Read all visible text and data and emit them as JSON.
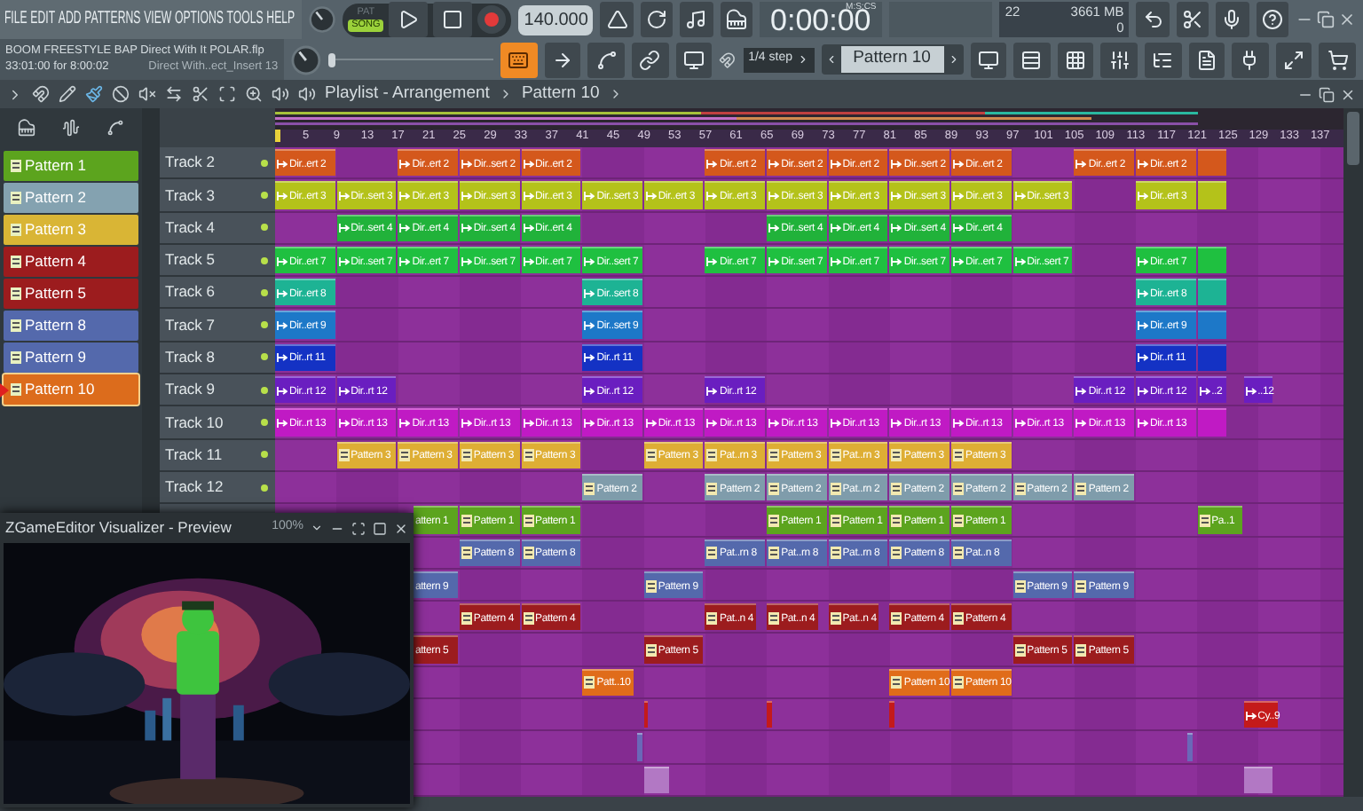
{
  "menu": [
    "FILE",
    "EDIT",
    "ADD",
    "PATTERNS",
    "VIEW",
    "OPTIONS",
    "TOOLS",
    "HELP"
  ],
  "transport": {
    "modes": [
      {
        "label": "PAT",
        "selected": false
      },
      {
        "label": "SONG",
        "selected": true
      }
    ],
    "tempo": "140.000",
    "time": "0:00:00",
    "time_unit": "M:S:CS",
    "cpu": "22",
    "memory": "3661 MB",
    "polyphony": "0"
  },
  "project": {
    "title": "BOOM FREESTYLE BAP Direct With It POLAR.flp",
    "position": "33:01:00 for 8:00:02",
    "hint": "Direct With..ect_Insert 13"
  },
  "pitch_slider": {
    "level": 0
  },
  "snap": "1/4 step",
  "pattern": "Pattern 10",
  "playlist": {
    "title": "Playlist - Arrangement",
    "crumb": "Pattern 10",
    "ruler": [
      "5",
      "9",
      "13",
      "17",
      "21",
      "25",
      "29",
      "33",
      "37",
      "41",
      "45",
      "49",
      "53",
      "57",
      "61",
      "65",
      "69",
      "73",
      "77",
      "81",
      "85",
      "89",
      "93",
      "97",
      "101",
      "105",
      "109",
      "113",
      "117",
      "121",
      "125",
      "129",
      "133",
      "137"
    ],
    "patterns": [
      {
        "label": "Pattern 1",
        "color": "#5ca41e",
        "selected": false
      },
      {
        "label": "Pattern 2",
        "color": "#84a2b0",
        "selected": false
      },
      {
        "label": "Pattern 3",
        "color": "#d9b535",
        "selected": false
      },
      {
        "label": "Pattern 4",
        "color": "#9c1c1e",
        "selected": false
      },
      {
        "label": "Pattern 5",
        "color": "#9c1c1e",
        "selected": false
      },
      {
        "label": "Pattern 8",
        "color": "#5469ac",
        "selected": false
      },
      {
        "label": "Pattern 9",
        "color": "#5469ac",
        "selected": false
      },
      {
        "label": "Pattern 10",
        "color": "#dc6c1c",
        "selected": true
      }
    ],
    "tracks": [
      {
        "name": "Track 2",
        "kind": "audio",
        "color": "#d4581c",
        "clips": [
          {
            "kind": "clip",
            "label": "Dir..ert 2"
          },
          {
            "kind": "clip",
            "label": "Dir..ert 2"
          },
          {
            "kind": "clip",
            "label": "Dir..sert 2"
          },
          {
            "kind": "clip",
            "label": "Dir..ert 2"
          },
          {
            "kind": "clip",
            "label": "Dir..ert 2"
          },
          {
            "kind": "clip",
            "label": "Dir..sert 2"
          },
          {
            "kind": "clip",
            "label": "Dir..ert 2"
          },
          {
            "kind": "clip",
            "label": "Dir..sert 2"
          },
          {
            "kind": "clip",
            "label": "Dir..ert 2"
          },
          {
            "kind": "clip",
            "label": "Dir..ert 2"
          },
          {
            "kind": "clip",
            "label": "Dir..ert 2"
          },
          {
            "kind": "blank"
          }
        ]
      },
      {
        "name": "Track 3",
        "kind": "audio",
        "color": "#b4c21a",
        "clips": [
          {
            "kind": "clip",
            "label": "Dir..ert 3"
          },
          {
            "kind": "clip",
            "label": "Dir..sert 3"
          },
          {
            "kind": "clip",
            "label": "Dir..ert 3"
          },
          {
            "kind": "clip",
            "label": "Dir..sert 3"
          },
          {
            "kind": "clip",
            "label": "Dir..ert 3"
          },
          {
            "kind": "clip",
            "label": "Dir..sert 3"
          },
          {
            "kind": "clip",
            "label": "Dir..ert 3"
          },
          {
            "kind": "clip",
            "label": "Dir..ert 3"
          },
          {
            "kind": "clip",
            "label": "Dir..sert 3"
          },
          {
            "kind": "clip",
            "label": "Dir..ert 3"
          },
          {
            "kind": "clip",
            "label": "Dir..sert 3"
          },
          {
            "kind": "clip",
            "label": "Dir..ert 3"
          },
          {
            "kind": "clip",
            "label": "Dir..sert 3"
          },
          {
            "kind": "clip",
            "label": "Dir..ert 3"
          },
          {
            "kind": "blank"
          }
        ]
      },
      {
        "name": "Track 4",
        "kind": "audio",
        "color": "#21b23a",
        "clips": [
          {
            "kind": "clip",
            "label": "Dir..sert 4"
          },
          {
            "kind": "clip",
            "label": "Dir..ert 4"
          },
          {
            "kind": "clip",
            "label": "Dir..sert 4"
          },
          {
            "kind": "clip",
            "label": "Dir..ert 4"
          },
          {
            "kind": "clip",
            "label": "Dir..sert 4"
          },
          {
            "kind": "clip",
            "label": "Dir..ert 4"
          },
          {
            "kind": "clip",
            "label": "Dir..sert 4"
          },
          {
            "kind": "clip",
            "label": "Dir..ert 4"
          }
        ]
      },
      {
        "name": "Track 5",
        "kind": "audio",
        "color": "#1fc040",
        "clips": [
          {
            "kind": "clip",
            "label": "Dir..ert 7"
          },
          {
            "kind": "clip",
            "label": "Dir..sert 7"
          },
          {
            "kind": "clip",
            "label": "Dir..ert 7"
          },
          {
            "kind": "clip",
            "label": "Dir..sert 7"
          },
          {
            "kind": "clip",
            "label": "Dir..ert 7"
          },
          {
            "kind": "clip",
            "label": "Dir..sert 7"
          },
          {
            "kind": "clip",
            "label": "Dir..ert 7"
          },
          {
            "kind": "clip",
            "label": "Dir..sert 7"
          },
          {
            "kind": "clip",
            "label": "Dir..ert 7"
          },
          {
            "kind": "clip",
            "label": "Dir..sert 7"
          },
          {
            "kind": "clip",
            "label": "Dir..ert 7"
          },
          {
            "kind": "clip",
            "label": "Dir..sert 7"
          },
          {
            "kind": "clip",
            "label": "Dir..ert 7"
          },
          {
            "kind": "blank"
          }
        ]
      },
      {
        "name": "Track 6",
        "kind": "audio",
        "color": "#1db394",
        "clips": [
          {
            "kind": "clip",
            "label": "Dir..ert 8"
          },
          {
            "kind": "clip",
            "label": "Dir..sert 8"
          },
          {
            "kind": "clip",
            "label": "Dir..ert 8"
          },
          {
            "kind": "blank"
          }
        ]
      },
      {
        "name": "Track 7",
        "kind": "audio",
        "color": "#1d78c8",
        "clips": [
          {
            "kind": "clip",
            "label": "Dir..ert 9"
          },
          {
            "kind": "clip",
            "label": "Dir..sert 9"
          },
          {
            "kind": "clip",
            "label": "Dir..ert 9"
          },
          {
            "kind": "blank"
          }
        ]
      },
      {
        "name": "Track 8",
        "kind": "audio",
        "color": "#1432c4",
        "clips": [
          {
            "kind": "clip",
            "label": "Dir..rt 11"
          },
          {
            "kind": "clip",
            "label": "Dir..rt 11"
          },
          {
            "kind": "clip",
            "label": "Dir..rt 11"
          },
          {
            "kind": "blank"
          }
        ]
      },
      {
        "name": "Track 9",
        "kind": "audio",
        "color": "#6a1ec0",
        "clips": [
          {
            "kind": "clip",
            "label": "Dir..rt 12"
          },
          {
            "kind": "clip",
            "label": "Dir..rt 12"
          },
          {
            "kind": "clip",
            "label": "Dir..rt 12"
          },
          {
            "kind": "clip",
            "label": "Dir..rt 12"
          },
          {
            "kind": "clip",
            "label": "Dir..rt 12"
          },
          {
            "kind": "clip",
            "label": "Dir..rt 12"
          },
          {
            "kind": "clip",
            "label": "..2"
          },
          {
            "kind": "clip",
            "label": "..12"
          }
        ]
      },
      {
        "name": "Track 10",
        "kind": "audio",
        "color": "#c01ac4",
        "clips": [
          {
            "kind": "clip",
            "label": "Dir..rt 13"
          },
          {
            "kind": "clip",
            "label": "Dir..rt 13"
          },
          {
            "kind": "clip",
            "label": "Dir..rt 13"
          },
          {
            "kind": "clip",
            "label": "Dir..rt 13"
          },
          {
            "kind": "clip",
            "label": "Dir..rt 13"
          },
          {
            "kind": "clip",
            "label": "Dir..rt 13"
          },
          {
            "kind": "clip",
            "label": "Dir..rt 13"
          },
          {
            "kind": "clip",
            "label": "Dir..rt 13"
          },
          {
            "kind": "clip",
            "label": "Dir..rt 13"
          },
          {
            "kind": "clip",
            "label": "Dir..rt 13"
          },
          {
            "kind": "clip",
            "label": "Dir..rt 13"
          },
          {
            "kind": "clip",
            "label": "Dir..rt 13"
          },
          {
            "kind": "clip",
            "label": "Dir..rt 13"
          },
          {
            "kind": "clip",
            "label": "Dir..rt 13"
          },
          {
            "kind": "clip",
            "label": "Dir..rt 13"
          },
          {
            "kind": "blank"
          }
        ]
      },
      {
        "name": "Track 11",
        "kind": "pattern",
        "color": "#deae34",
        "clips": [
          {
            "kind": "clip",
            "label": "Pattern 3"
          },
          {
            "kind": "clip",
            "label": "Pattern 3"
          },
          {
            "kind": "clip",
            "label": "Pattern 3"
          },
          {
            "kind": "clip",
            "label": "Pattern 3"
          },
          {
            "kind": "clip",
            "label": "Pattern 3"
          },
          {
            "kind": "clip",
            "label": "Pat..rn 3"
          },
          {
            "kind": "clip",
            "label": "Pattern 3"
          },
          {
            "kind": "clip",
            "label": "Pat..rn 3"
          },
          {
            "kind": "clip",
            "label": "Pattern 3"
          },
          {
            "kind": "clip",
            "label": "Pattern 3"
          }
        ]
      },
      {
        "name": "Track 12",
        "kind": "pattern",
        "color": "#7f9cab",
        "clips": [
          {
            "kind": "clip",
            "label": "Pattern 2"
          },
          {
            "kind": "clip",
            "label": "Pattern 2"
          },
          {
            "kind": "clip",
            "label": "Pattern 2"
          },
          {
            "kind": "clip",
            "label": "Pat..rn 2"
          },
          {
            "kind": "clip",
            "label": "Pattern 2"
          },
          {
            "kind": "clip",
            "label": "Pattern 2"
          },
          {
            "kind": "clip",
            "label": "Pattern 2"
          },
          {
            "kind": "clip",
            "label": "Pattern 2"
          }
        ]
      },
      {
        "kind": "pattern",
        "color": "#5ca41e",
        "clips": [
          {
            "kind": "cut",
            "label": "attern 1"
          },
          {
            "kind": "clip",
            "label": "Pattern 1"
          },
          {
            "kind": "clip",
            "label": "Pattern 1"
          },
          {
            "kind": "clip",
            "label": "Pattern 1"
          },
          {
            "kind": "clip",
            "label": "Pattern 1"
          },
          {
            "kind": "clip",
            "label": "Pattern 1"
          },
          {
            "kind": "clip",
            "label": "Pattern 1"
          },
          {
            "kind": "clip",
            "label": "Pa..1"
          }
        ]
      },
      {
        "kind": "pattern",
        "color": "#5469ac",
        "clips": [
          {
            "kind": "clip",
            "label": "Pattern 8"
          },
          {
            "kind": "clip",
            "label": "Pattern 8"
          },
          {
            "kind": "clip",
            "label": "Pat..rn 8"
          },
          {
            "kind": "clip",
            "label": "Pat..rn 8"
          },
          {
            "kind": "clip",
            "label": "Pat..rn 8"
          },
          {
            "kind": "clip",
            "label": "Pattern 8"
          },
          {
            "kind": "clip",
            "label": "Pat..n 8"
          }
        ]
      },
      {
        "kind": "pattern",
        "color": "#5469ac",
        "clips": [
          {
            "kind": "cut",
            "label": "attern 9"
          },
          {
            "kind": "clip",
            "label": "Pattern 9"
          },
          {
            "kind": "clip",
            "label": "Pattern 9"
          },
          {
            "kind": "clip",
            "label": "Pattern 9"
          }
        ]
      },
      {
        "kind": "pattern",
        "color": "#9c1c1e",
        "clips": [
          {
            "kind": "clip",
            "label": "Pattern 4"
          },
          {
            "kind": "clip",
            "label": "Pattern 4"
          },
          {
            "kind": "clip",
            "label": "Pat..n 4"
          },
          {
            "kind": "clip",
            "label": "Pat..n 4"
          },
          {
            "kind": "clip",
            "label": "Pat..n 4"
          },
          {
            "kind": "clip",
            "label": "Pattern 4"
          },
          {
            "kind": "clip",
            "label": "Pattern 4"
          }
        ]
      },
      {
        "kind": "pattern",
        "color": "#9c1c1e",
        "clips": [
          {
            "kind": "cut",
            "label": "attern 5"
          },
          {
            "kind": "clip",
            "label": "Pattern 5"
          },
          {
            "kind": "clip",
            "label": "Pattern 5"
          },
          {
            "kind": "clip",
            "label": "Pattern 5"
          }
        ]
      },
      {
        "kind": "pattern",
        "color": "#e06c1a",
        "clips": [
          {
            "kind": "clip",
            "label": "Patt..10"
          },
          {
            "kind": "clip",
            "label": "Pattern 10"
          },
          {
            "kind": "clip",
            "label": "Pattern 10"
          }
        ]
      },
      {
        "kind": "audio",
        "color": "#c41a1a",
        "clips": [
          {
            "kind": "blank"
          },
          {
            "kind": "blank"
          },
          {
            "kind": "blank"
          },
          {
            "kind": "clip",
            "label": "Cy..9"
          }
        ]
      },
      {
        "kind": "audio",
        "color": "#6a68b8",
        "clips": [
          {
            "kind": "blank"
          },
          {
            "kind": "blank"
          }
        ]
      },
      {
        "kind": "audio",
        "color": "#b278c4",
        "clips": [
          {
            "kind": "blank"
          },
          {
            "kind": "blank"
          }
        ]
      }
    ]
  },
  "preview": {
    "title": "ZGameEditor Visualizer - Preview",
    "zoom": "100%",
    "kind": "picture"
  }
}
